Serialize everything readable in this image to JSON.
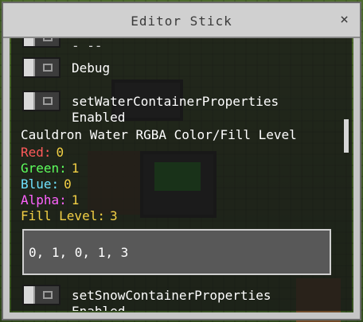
{
  "window": {
    "title": "Editor Stick",
    "close_label": "×"
  },
  "rows": {
    "partial_label": "- --",
    "debug_label": "Debug",
    "water_label": "setWaterContainerProperties",
    "water_sub": "Enabled",
    "snow_label": "setSnowContainerProperties",
    "snow_sub": "Enabled"
  },
  "cauldron": {
    "heading": "Cauldron Water RGBA Color/Fill Level",
    "red": {
      "label": "Red:",
      "value": "0",
      "color": "#ff5a5a"
    },
    "green": {
      "label": "Green:",
      "value": "1",
      "color": "#5dff5d"
    },
    "blue": {
      "label": "Blue:",
      "value": "0",
      "color": "#6fe2ff"
    },
    "alpha": {
      "label": "Alpha:",
      "value": "1",
      "color": "#ff63ff"
    },
    "fill": {
      "label": "Fill Level:",
      "value": "3",
      "color": "#f3d045"
    }
  },
  "input": {
    "value": "0, 1, 0, 1, 3"
  },
  "colors": {
    "value_yellow": "#f3d045",
    "panel_bg": "#181818",
    "titlebar": "#d0d0d0"
  }
}
